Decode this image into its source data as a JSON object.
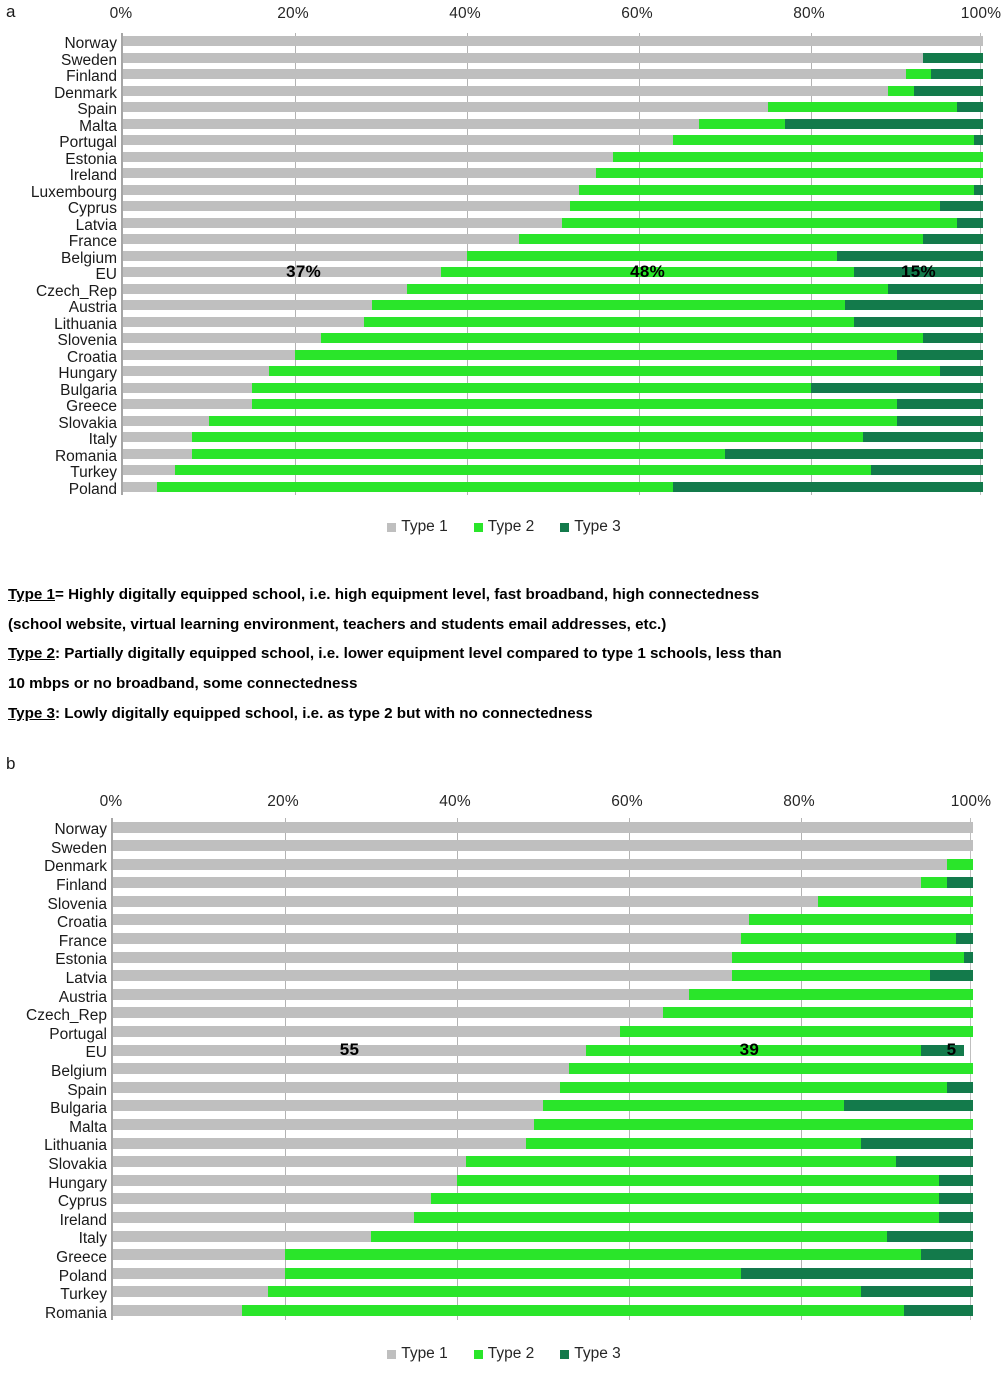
{
  "panels": {
    "a": {
      "letter": "a"
    },
    "b": {
      "letter": "b"
    }
  },
  "legend": {
    "items": [
      {
        "label": "Type 1",
        "color": "#bfbfbf"
      },
      {
        "label": "Type 2",
        "color": "#2ae52a"
      },
      {
        "label": "Type 3",
        "color": "#137a4b"
      }
    ]
  },
  "notes": {
    "type1_key": "Type 1",
    "type1_text": "= Highly digitally equipped school, i.e. high equipment level, fast broadband, high connectedness",
    "type1_text2": "(school website, virtual learning environment, teachers and students email addresses, etc.)",
    "type2_key": "Type 2",
    "type2_text": ": Partially digitally equipped school, i.e. lower equipment level compared to type 1 schools, less than",
    "type2_text2": "10 mbps or no broadband, some connectedness",
    "type3_key": "Type 3",
    "type3_text": ": Lowly digitally equipped school, i.e. as type 2 but with no connectedness"
  },
  "chart_data": [
    {
      "id": "chart-a",
      "type": "bar",
      "orientation": "horizontal",
      "stacked": true,
      "stack_total": 100,
      "title": "",
      "xlabel": "",
      "ylabel": "",
      "xlim": [
        0,
        100
      ],
      "xticks": [
        "0%",
        "20%",
        "40%",
        "60%",
        "80%",
        "100%"
      ],
      "xtick_values": [
        0,
        20,
        40,
        60,
        80,
        100
      ],
      "grid": true,
      "legend_position": "bottom",
      "series": [
        {
          "name": "Type 1",
          "color": "#bfbfbf",
          "values": [
            100,
            93,
            91,
            89,
            75,
            67,
            64,
            57,
            55,
            53,
            52,
            51,
            46,
            40,
            37,
            33,
            29,
            28,
            23,
            20,
            17,
            15,
            15,
            10,
            8,
            8,
            6,
            4
          ]
        },
        {
          "name": "Type 2",
          "color": "#2ae52a",
          "values": [
            0,
            0,
            3,
            3,
            22,
            10,
            35,
            43,
            45,
            46,
            43,
            46,
            47,
            43,
            48,
            56,
            55,
            57,
            70,
            70,
            78,
            65,
            75,
            80,
            78,
            62,
            81,
            60
          ]
        },
        {
          "name": "Type 3",
          "color": "#137a4b",
          "values": [
            0,
            7,
            6,
            8,
            3,
            23,
            1,
            0,
            0,
            1,
            5,
            3,
            7,
            17,
            15,
            11,
            16,
            15,
            7,
            10,
            5,
            20,
            10,
            10,
            14,
            30,
            13,
            36
          ]
        }
      ],
      "categories": [
        "Norway",
        "Sweden",
        "Finland",
        "Denmark",
        "Spain",
        "Malta",
        "Portugal",
        "Estonia",
        "Ireland",
        "Luxembourg",
        "Cyprus",
        "Latvia",
        "France",
        "Belgium",
        "EU",
        "Czech_Rep",
        "Austria",
        "Lithuania",
        "Slovenia",
        "Croatia",
        "Hungary",
        "Bulgaria",
        "Greece",
        "Slovakia",
        "Italy",
        "Romania",
        "Turkey",
        "Poland"
      ],
      "annotations": [
        {
          "text": "37%",
          "category": "EU",
          "x": 21
        },
        {
          "text": "48%",
          "category": "EU",
          "x": 61
        },
        {
          "text": "15%",
          "category": "EU",
          "x": 92.5
        }
      ]
    },
    {
      "id": "chart-b",
      "type": "bar",
      "orientation": "horizontal",
      "stacked": true,
      "stack_total": 100,
      "title": "",
      "xlabel": "",
      "ylabel": "",
      "xlim": [
        0,
        100
      ],
      "xticks": [
        "0%",
        "20%",
        "40%",
        "60%",
        "80%",
        "100%"
      ],
      "xtick_values": [
        0,
        20,
        40,
        60,
        80,
        100
      ],
      "grid": true,
      "legend_position": "bottom",
      "series": [
        {
          "name": "Type 1",
          "color": "#bfbfbf",
          "values": [
            100,
            100,
            97,
            94,
            82,
            74,
            73,
            72,
            72,
            67,
            64,
            59,
            55,
            53,
            52,
            50,
            49,
            48,
            41,
            40,
            37,
            35,
            30,
            20,
            20,
            18,
            15
          ]
        },
        {
          "name": "Type 2",
          "color": "#2ae52a",
          "values": [
            0,
            0,
            3,
            3,
            18,
            26,
            25,
            27,
            23,
            33,
            36,
            41,
            39,
            47,
            45,
            35,
            51,
            39,
            50,
            56,
            59,
            61,
            60,
            74,
            53,
            69,
            77
          ]
        },
        {
          "name": "Type 3",
          "color": "#137a4b",
          "values": [
            0,
            0,
            0,
            3,
            0,
            0,
            2,
            1,
            5,
            0,
            0,
            0,
            5,
            0,
            3,
            15,
            0,
            13,
            9,
            4,
            4,
            4,
            10,
            6,
            27,
            13,
            8
          ]
        }
      ],
      "categories": [
        "Norway",
        "Sweden",
        "Denmark",
        "Finland",
        "Slovenia",
        "Croatia",
        "France",
        "Estonia",
        "Latvia",
        "Austria",
        "Czech_Rep",
        "Portugal",
        "EU",
        "Belgium",
        "Spain",
        "Bulgaria",
        "Malta",
        "Lithuania",
        "Slovakia",
        "Hungary",
        "Cyprus",
        "Ireland",
        "Italy",
        "Greece",
        "Poland",
        "Turkey",
        "Romania"
      ],
      "annotations": [
        {
          "text": "55",
          "category": "EU",
          "x": 27.5
        },
        {
          "text": "39",
          "category": "EU",
          "x": 74
        },
        {
          "text": "5",
          "category": "EU",
          "x": 97.5
        }
      ]
    }
  ]
}
